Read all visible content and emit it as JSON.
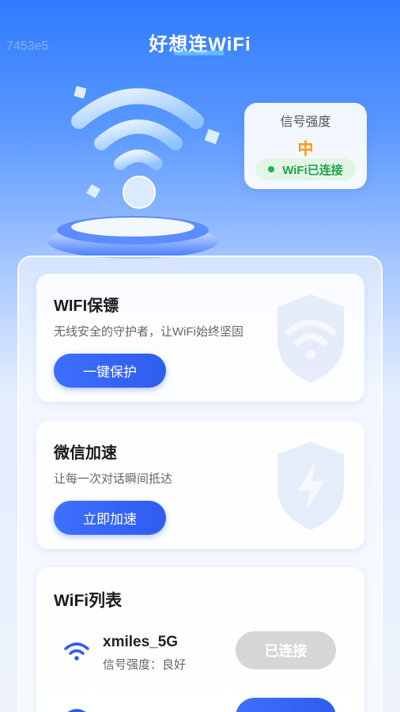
{
  "watermark": "7453e5",
  "app": {
    "title": "好想连WiFi"
  },
  "signal": {
    "title": "信号强度",
    "level": "中",
    "status": "WiFi已连接",
    "status_color": "#1ea34a",
    "level_color": "#ff9500"
  },
  "cards": [
    {
      "title": "WIFI保镖",
      "subtitle": "无线安全的守护者，让WiFi始终坚固",
      "button": "一键保护",
      "icon": "shield-wifi-icon"
    },
    {
      "title": "微信加速",
      "subtitle": "让每一次对话瞬间抵达",
      "button": "立即加速",
      "icon": "shield-bolt-icon"
    }
  ],
  "wifi_list": {
    "title": "WiFi列表",
    "networks": [
      {
        "name": "xmiles_5G",
        "signal": "信号强度：良好",
        "action": "已连接",
        "connected": true
      }
    ]
  },
  "colors": {
    "accent": "#3d6fff",
    "header_blue": "#2f7bff"
  }
}
